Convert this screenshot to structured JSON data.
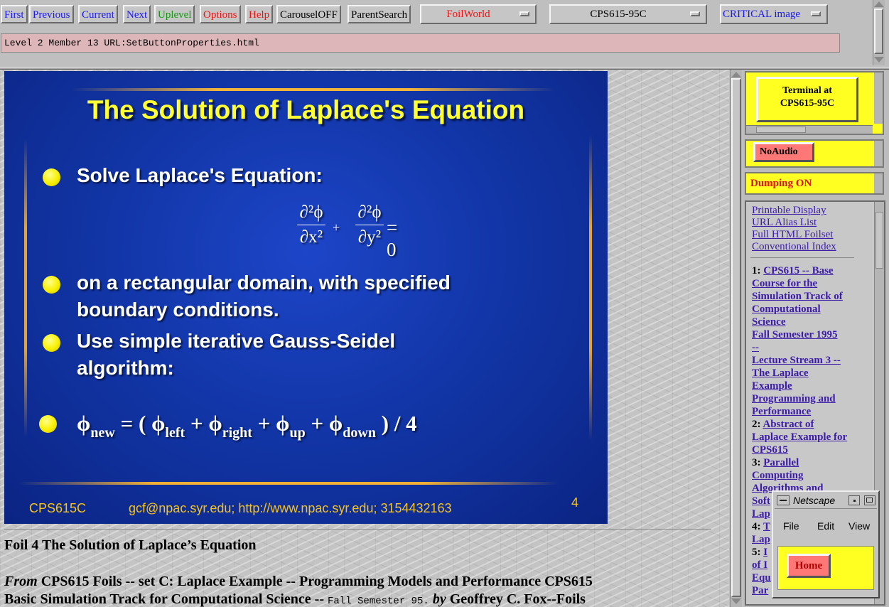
{
  "toolbar": {
    "buttons": [
      {
        "label": "First"
      },
      {
        "label": "Previous"
      },
      {
        "label": "Current"
      },
      {
        "label": "Next"
      },
      {
        "label": "Uplevel"
      },
      {
        "label": "Options"
      },
      {
        "label": "Help"
      },
      {
        "label": "CarouselOFF"
      },
      {
        "label": "ParentSearch"
      }
    ],
    "selects": [
      {
        "value": "FoilWorld"
      },
      {
        "value": "CPS615-95C"
      },
      {
        "value": "CRITICAL image"
      }
    ]
  },
  "url_bar": "Level 2 Member 13 URL:SetButtonProperties.html",
  "slide": {
    "title": "The Solution of Laplace's Equation",
    "bullet1": "Solve Laplace's Equation:",
    "eq": {
      "num1": "∂²ϕ",
      "den1": "∂x²",
      "plus": "+",
      "num2": "∂²ϕ",
      "den2": "∂y²",
      "rhs": "= 0"
    },
    "bullet2a": "on a rectangular domain, with specified",
    "bullet2b": "boundary conditions.",
    "bullet3a": "Use simple iterative Gauss-Seidel",
    "bullet3b": "algorithm:",
    "formula": {
      "phi": "ϕ",
      "sub_new": "new",
      "eq_open": " = ( ",
      "sub_left": "left",
      "plus": " + ",
      "sub_right": "right",
      "sub_up": "up",
      "sub_down": "down",
      "close": " ) / 4"
    },
    "footer_left": "CPS615C",
    "footer_center": "gcf@npac.syr.edu; http://www.npac.syr.edu; 3154432163",
    "footer_page": "4"
  },
  "caption": "Foil 4 The Solution of Laplace’s Equation",
  "from_line": {
    "from": "From",
    "text1": " CPS615 Foils -- set C: Laplace Example -- Programming Models and Performance CPS615",
    "text2": "Basic Simulation Track for Computational Science -- ",
    "mono": "Fall Semester 95.",
    "by": " by",
    "author": " Geoffrey C. Fox--Foils"
  },
  "right": {
    "terminal_label_1": "Terminal at",
    "terminal_label_2": "CPS615-95C",
    "noaudio": "NoAudio",
    "dumping": "Dumping ON",
    "links": [
      "Printable Display",
      "URL Alias List",
      "Full HTML Foilset",
      "Conventional Index"
    ],
    "foils": [
      {
        "num": "1:",
        "lines": [
          "CPS615 -- Base",
          "Course for the",
          "Simulation Track of",
          "Computational",
          "Science",
          "Fall Semester 1995",
          "--",
          "Lecture Stream 3 --",
          "The Laplace",
          "Example",
          "Programming and",
          "Performance "
        ]
      },
      {
        "num": "2:",
        "lines": [
          "Abstract of",
          "Laplace Example for",
          "CPS615 "
        ]
      },
      {
        "num": "3:",
        "lines": [
          "Parallel",
          "Computing ",
          "Algorithms and",
          "Soft",
          "Lap"
        ]
      },
      {
        "num": "4:",
        "lines": [
          "T",
          "Lap"
        ]
      },
      {
        "num": "5:",
        "lines": [
          "I",
          "of I",
          "Equ",
          "Par"
        ]
      }
    ]
  },
  "popup": {
    "title": "Netscape",
    "menu": [
      "File",
      "Edit",
      "View"
    ],
    "home": "Home"
  }
}
